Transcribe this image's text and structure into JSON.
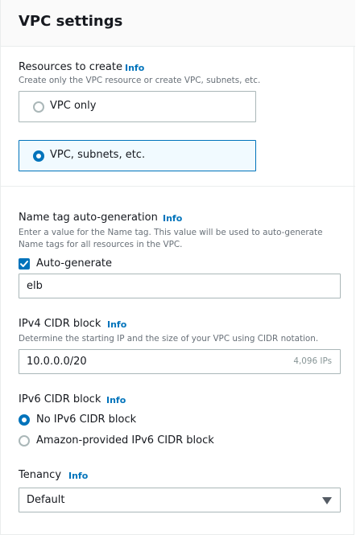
{
  "panel": {
    "title": "VPC settings"
  },
  "resources": {
    "label": "Resources to create",
    "info": "Info",
    "description": "Create only the VPC resource or create VPC, subnets, etc.",
    "options": [
      {
        "label": "VPC only",
        "selected": false
      },
      {
        "label": "VPC, subnets, etc.",
        "selected": true
      }
    ]
  },
  "name_tag": {
    "label": "Name tag auto-generation",
    "info": "Info",
    "description_line1": "Enter a value for the Name tag. This value will be used to auto-generate",
    "description_line2": "Name tags for all resources in the VPC.",
    "checkbox_label": "Auto-generate",
    "checkbox_checked": true,
    "value": "elb"
  },
  "ipv4": {
    "label": "IPv4 CIDR block",
    "info": "Info",
    "description": "Determine the starting IP and the size of your VPC using CIDR notation.",
    "value": "10.0.0.0/20",
    "hint": "4,096 IPs"
  },
  "ipv6": {
    "label": "IPv6 CIDR block",
    "info": "Info",
    "options": [
      {
        "label": "No IPv6 CIDR block",
        "selected": true
      },
      {
        "label": "Amazon-provided IPv6 CIDR block",
        "selected": false
      }
    ]
  },
  "tenancy": {
    "label": "Tenancy",
    "info": "Info",
    "selected": "Default"
  },
  "colors": {
    "accent": "#0073bb",
    "text": "#16191f",
    "muted": "#687078",
    "border": "#aab7b8"
  },
  "icons": {
    "checkbox": "check-icon",
    "select": "caret-down-icon"
  }
}
